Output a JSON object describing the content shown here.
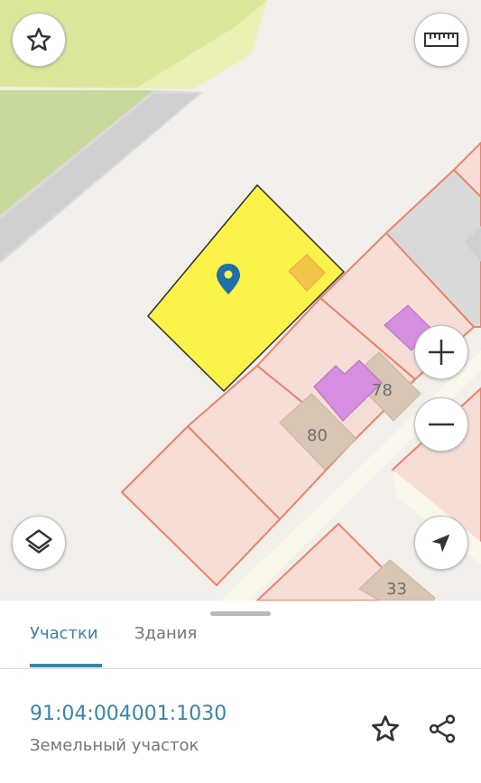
{
  "map": {
    "house_numbers": [
      "78",
      "80",
      "33"
    ],
    "icons": {
      "favorite": "star-outline-icon",
      "ruler": "ruler-icon",
      "layers": "layers-icon",
      "zoom_in": "plus-icon",
      "zoom_out": "minus-icon",
      "location": "navigation-arrow-icon",
      "marker": "location-pin-icon"
    },
    "colors": {
      "background": "#f2eeea",
      "parcel_border": "#e8846e",
      "parcel_fill": "#f6ddd5",
      "selected_parcel": "#fbf24a",
      "green_zone": "#dbe79b",
      "building": "#d8c5b3",
      "highlighted_building": "#d68ee0",
      "marker": "#1f6fa8"
    }
  },
  "sheet": {
    "tabs": [
      {
        "label": "Участки",
        "active": true
      },
      {
        "label": "Здания",
        "active": false
      }
    ],
    "cadastral_number": "91:04:004001:1030",
    "object_type": "Земельный участок",
    "accent_color": "#3a84a6",
    "icons": {
      "favorite": "star-outline-icon",
      "share": "share-icon"
    }
  }
}
